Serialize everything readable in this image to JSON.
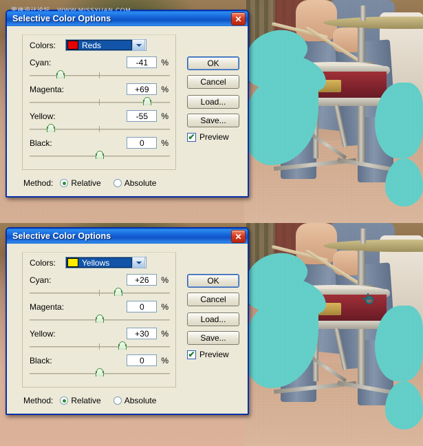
{
  "watermark": {
    "cn": "思缘设计论坛",
    "url": "WWW.MISSYUAN.COM"
  },
  "dialogs": [
    {
      "title": "Selective Color Options",
      "close_label": "✕",
      "colors": {
        "label": "Colors:",
        "value": "Reds",
        "swatch_color": "#e60000",
        "arrow_icon": "chevron-down-icon"
      },
      "channels": [
        {
          "label": "Cyan:",
          "value": "-41",
          "unit": "%",
          "pos": 22
        },
        {
          "label": "Magenta:",
          "value": "+69",
          "unit": "%",
          "pos": 84
        },
        {
          "label": "Yellow:",
          "value": "-55",
          "unit": "%",
          "pos": 15
        },
        {
          "label": "Black:",
          "value": "0",
          "unit": "%",
          "pos": 50
        }
      ],
      "buttons": {
        "ok": "OK",
        "cancel": "Cancel",
        "load": "Load...",
        "save": "Save..."
      },
      "preview": {
        "label": "Preview",
        "checked": true,
        "check_glyph": "✔"
      },
      "method": {
        "label": "Method:",
        "options": [
          "Relative",
          "Absolute"
        ],
        "selected": "Relative"
      }
    },
    {
      "title": "Selective Color Options",
      "close_label": "✕",
      "colors": {
        "label": "Colors:",
        "value": "Yellows",
        "swatch_color": "#ffec00",
        "arrow_icon": "chevron-down-icon"
      },
      "channels": [
        {
          "label": "Cyan:",
          "value": "+26",
          "unit": "%",
          "pos": 63
        },
        {
          "label": "Magenta:",
          "value": "0",
          "unit": "%",
          "pos": 50
        },
        {
          "label": "Yellow:",
          "value": "+30",
          "unit": "%",
          "pos": 66
        },
        {
          "label": "Black:",
          "value": "0",
          "unit": "%",
          "pos": 50
        }
      ],
      "buttons": {
        "ok": "OK",
        "cancel": "Cancel",
        "load": "Load...",
        "save": "Save..."
      },
      "preview": {
        "label": "Preview",
        "checked": true,
        "check_glyph": "✔"
      },
      "method": {
        "label": "Method:",
        "options": [
          "Relative",
          "Absolute"
        ],
        "selected": "Relative"
      }
    }
  ],
  "canvas": {
    "description": "drummer-photo-with-teal-swirls",
    "cursor": "eyedropper-cursor"
  },
  "colors": {
    "titlebar": "#1564d8",
    "dialog_face": "#ece9d8",
    "accent": "#0a2fa8",
    "teal": "#63cfc8"
  }
}
